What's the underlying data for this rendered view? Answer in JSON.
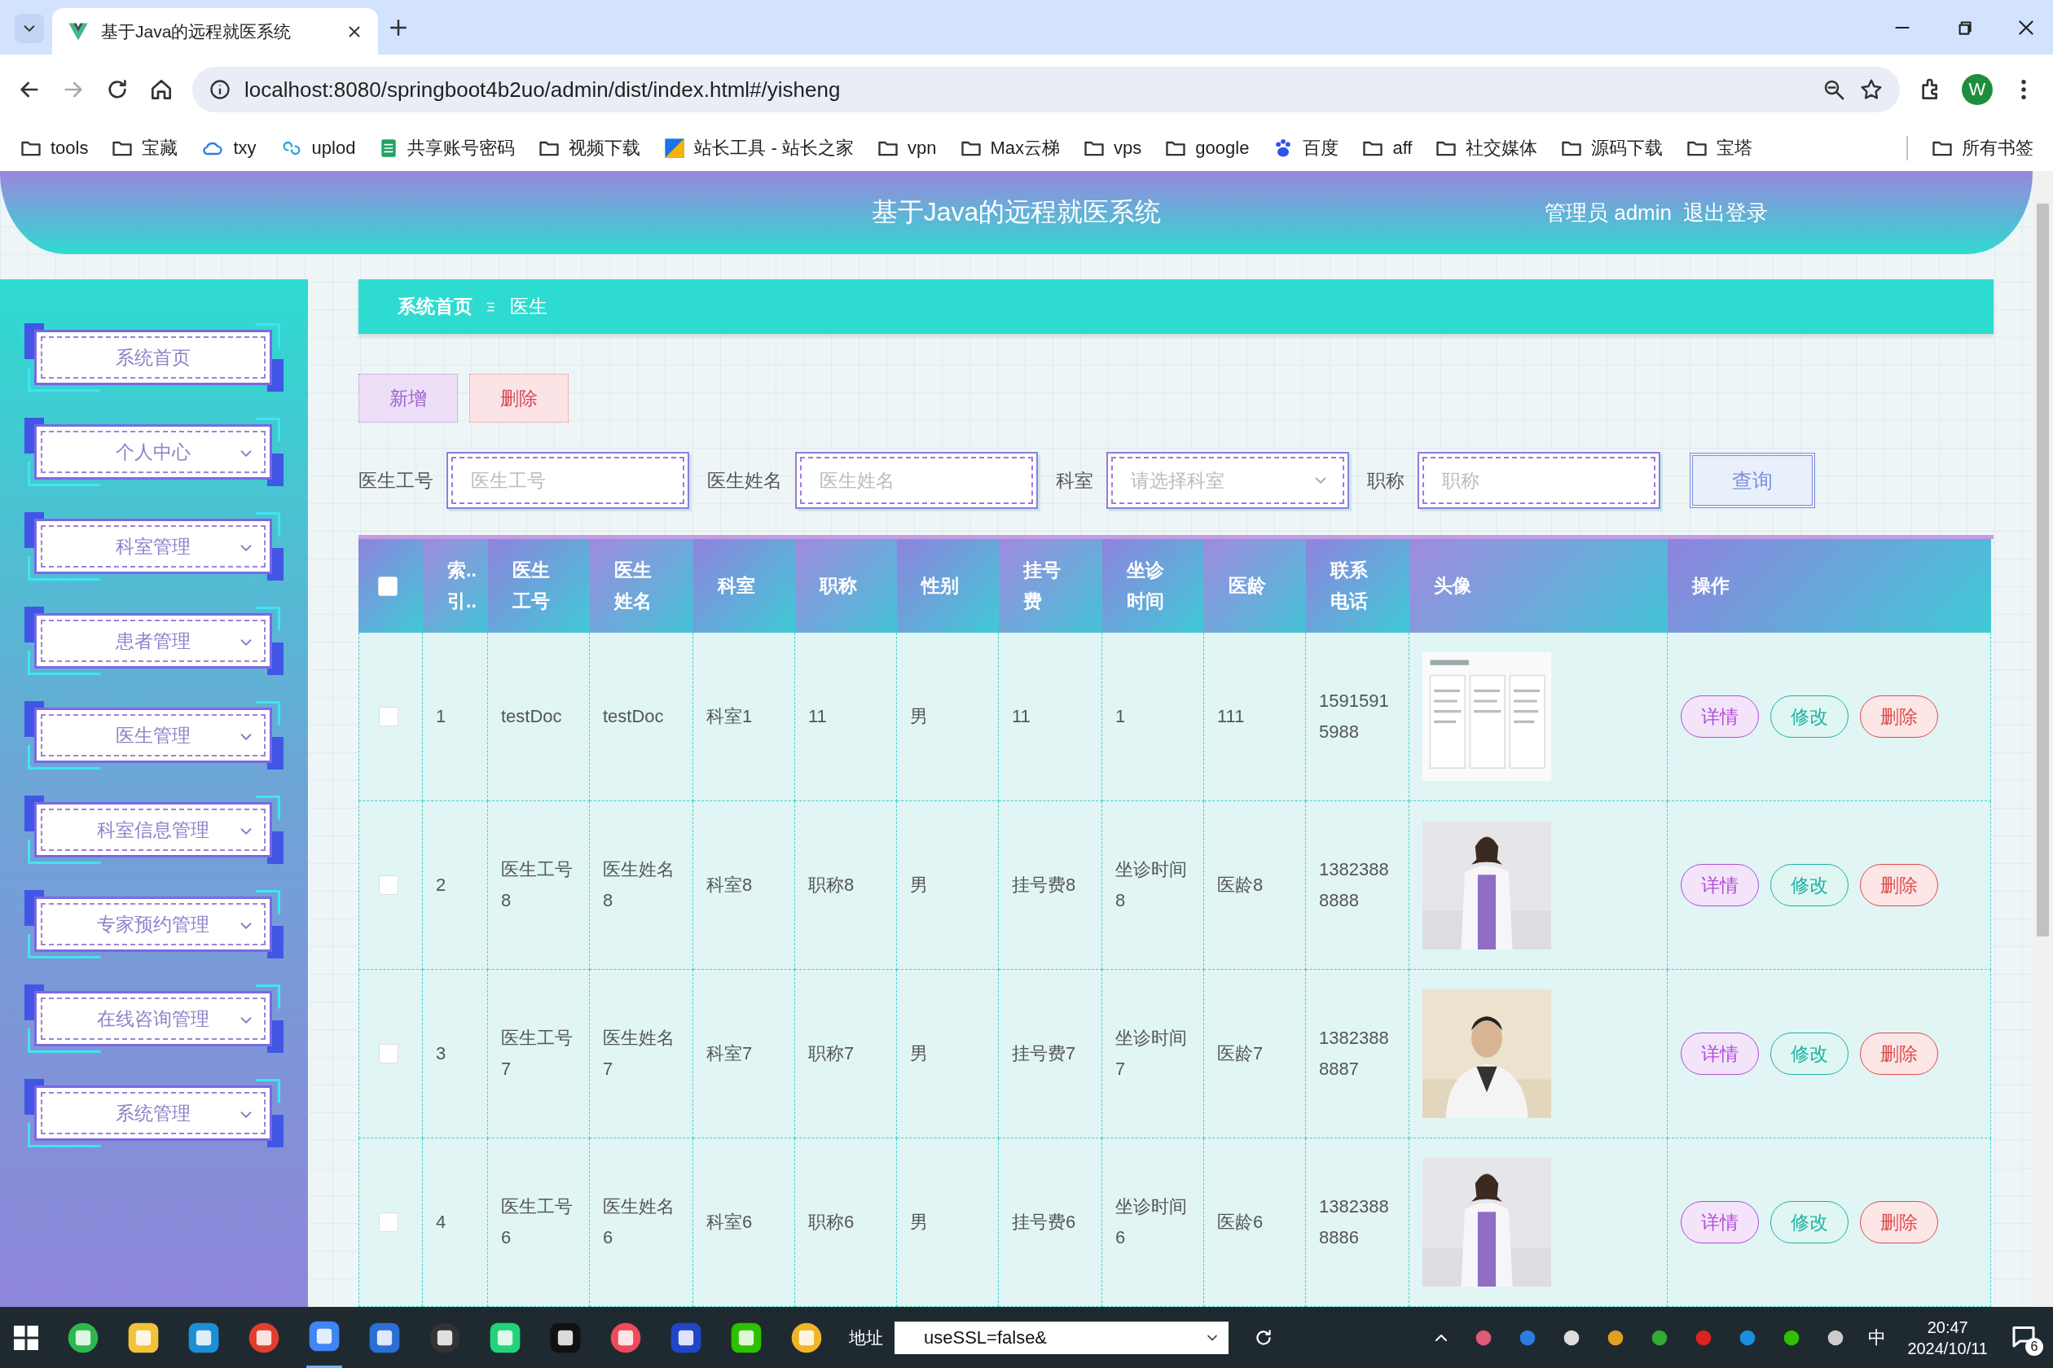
{
  "browser": {
    "tab_title": "基于Java的远程就医系统",
    "url": "localhost:8080/springboot4b2uo/admin/dist/index.html#/yisheng",
    "profile_initial": "W",
    "all_bookmarks": "所有书签",
    "bookmarks": [
      {
        "label": "tools",
        "kind": "folder"
      },
      {
        "label": "宝藏",
        "kind": "folder"
      },
      {
        "label": "txy",
        "kind": "cloud"
      },
      {
        "label": "uplod",
        "kind": "link"
      },
      {
        "label": "共享账号密码",
        "kind": "sheet"
      },
      {
        "label": "视频下载",
        "kind": "folder"
      },
      {
        "label": "站长工具 - 站长之家",
        "kind": "site"
      },
      {
        "label": "vpn",
        "kind": "folder"
      },
      {
        "label": "Max云梯",
        "kind": "folder"
      },
      {
        "label": "vps",
        "kind": "folder"
      },
      {
        "label": "google",
        "kind": "folder"
      },
      {
        "label": "百度",
        "kind": "paw"
      },
      {
        "label": "aff",
        "kind": "folder"
      },
      {
        "label": "社交媒体",
        "kind": "folder"
      },
      {
        "label": "源码下载",
        "kind": "folder"
      },
      {
        "label": "宝塔",
        "kind": "folder"
      }
    ]
  },
  "header": {
    "title": "基于Java的远程就医系统",
    "user": "管理员 admin",
    "logout": "退出登录"
  },
  "sidebar": [
    {
      "label": "系统首页",
      "expandable": false
    },
    {
      "label": "个人中心",
      "expandable": true
    },
    {
      "label": "科室管理",
      "expandable": true
    },
    {
      "label": "患者管理",
      "expandable": true
    },
    {
      "label": "医生管理",
      "expandable": true
    },
    {
      "label": "科室信息管理",
      "expandable": true
    },
    {
      "label": "专家预约管理",
      "expandable": true
    },
    {
      "label": "在线咨询管理",
      "expandable": true
    },
    {
      "label": "系统管理",
      "expandable": true
    }
  ],
  "breadcrumb": [
    {
      "label": "系统首页",
      "current": false
    },
    {
      "label": "医生",
      "current": true
    }
  ],
  "actions": [
    {
      "label": "新增",
      "kind": "add"
    },
    {
      "label": "删除",
      "kind": "delete"
    }
  ],
  "search": {
    "fields": [
      {
        "label": "医生工号",
        "placeholder": "医生工号",
        "kind": "input"
      },
      {
        "label": "医生姓名",
        "placeholder": "医生姓名",
        "kind": "input"
      },
      {
        "label": "科室",
        "placeholder": "请选择科室",
        "kind": "select"
      },
      {
        "label": "职称",
        "placeholder": "职称",
        "kind": "input"
      }
    ],
    "button": "查询"
  },
  "table": {
    "all_checked": false,
    "columns": [
      "索.. 引..",
      "医生工号",
      "医生姓名",
      "科室",
      "职称",
      "性别",
      "挂号费",
      "坐诊时间",
      "医龄",
      "联系电话",
      "头像",
      "操作"
    ],
    "rows": [
      {
        "checked": false,
        "cells": [
          "1",
          "testDoc",
          "testDoc",
          "科室1",
          "11",
          "男",
          "11",
          "1",
          "111",
          "15915915988"
        ],
        "actions": [
          {
            "label": "详情",
            "kind": "detail"
          },
          {
            "label": "修改",
            "kind": "edit"
          },
          {
            "label": "删除",
            "kind": "delete"
          }
        ]
      },
      {
        "checked": false,
        "cells": [
          "2",
          "医生工号8",
          "医生姓名8",
          "科室8",
          "职称8",
          "男",
          "挂号费8",
          "坐诊时间8",
          "医龄8",
          "13823888888"
        ],
        "actions": [
          {
            "label": "详情",
            "kind": "detail"
          },
          {
            "label": "修改",
            "kind": "edit"
          },
          {
            "label": "删除",
            "kind": "delete"
          }
        ]
      },
      {
        "checked": false,
        "cells": [
          "3",
          "医生工号7",
          "医生姓名7",
          "科室7",
          "职称7",
          "男",
          "挂号费7",
          "坐诊时间7",
          "医龄7",
          "13823888887"
        ],
        "actions": [
          {
            "label": "详情",
            "kind": "detail"
          },
          {
            "label": "修改",
            "kind": "edit"
          },
          {
            "label": "删除",
            "kind": "delete"
          }
        ]
      },
      {
        "checked": false,
        "cells": [
          "4",
          "医生工号6",
          "医生姓名6",
          "科室6",
          "职称6",
          "男",
          "挂号费6",
          "坐诊时间6",
          "医龄6",
          "13823888886"
        ],
        "actions": [
          {
            "label": "详情",
            "kind": "detail"
          },
          {
            "label": "修改",
            "kind": "edit"
          },
          {
            "label": "删除",
            "kind": "delete"
          }
        ]
      }
    ]
  },
  "taskbar": {
    "address_label": "地址",
    "address_value": "useSSL=false&",
    "ime": "中",
    "time": "20:47",
    "date": "2024/10/11",
    "notifications": "6"
  }
}
